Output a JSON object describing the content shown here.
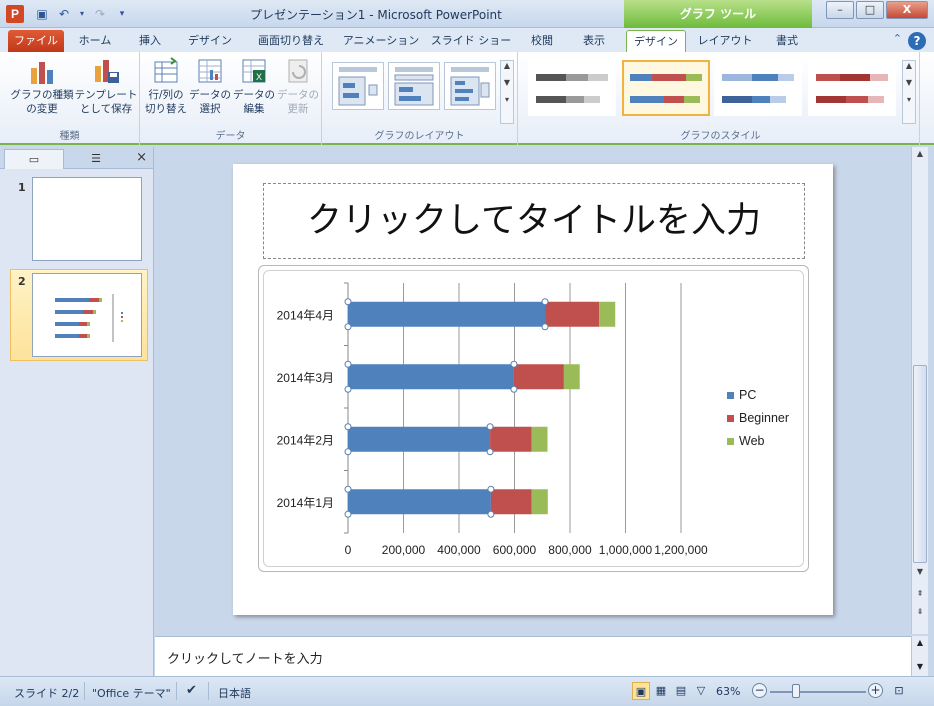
{
  "window": {
    "title": "プレゼンテーション1 - Microsoft PowerPoint",
    "contextual_tab": "グラフ ツール",
    "controls": {
      "minimize": "–",
      "maximize": "□",
      "close": "X"
    }
  },
  "tabs": [
    {
      "label": "ファイル"
    },
    {
      "label": "ホーム"
    },
    {
      "label": "挿入"
    },
    {
      "label": "デザイン"
    },
    {
      "label": "画面切り替え"
    },
    {
      "label": "アニメーション"
    },
    {
      "label": "スライド ショー"
    },
    {
      "label": "校閲"
    },
    {
      "label": "表示"
    },
    {
      "label": "デザイン"
    },
    {
      "label": "レイアウト"
    },
    {
      "label": "書式"
    }
  ],
  "ribbon": {
    "groups": {
      "type": {
        "label": "種類",
        "change_chart_type": "グラフの種類\nの変更",
        "save_template": "テンプレート\nとして保存"
      },
      "data": {
        "label": "データ",
        "switch_row_col": "行/列の\n切り替え",
        "select_data": "データの\n選択",
        "edit_data": "データの\n編集",
        "refresh_data": "データの\n更新"
      },
      "layouts": {
        "label": "グラフのレイアウト"
      },
      "styles": {
        "label": "グラフのスタイル"
      }
    }
  },
  "left_pane": {
    "slides": [
      {
        "number": "1"
      },
      {
        "number": "2"
      }
    ],
    "close": "×"
  },
  "slide": {
    "title_placeholder": "クリックしてタイトルを入力"
  },
  "chart_data": {
    "type": "bar",
    "orientation": "horizontal",
    "stacked": true,
    "categories": [
      "2014年1月",
      "2014年2月",
      "2014年3月",
      "2014年4月"
    ],
    "series": [
      {
        "name": "PC",
        "color": "#4f81bd",
        "values": [
          515000,
          512000,
          598000,
          710000
        ]
      },
      {
        "name": "Beginner",
        "color": "#c0504d",
        "values": [
          147000,
          150000,
          180000,
          195000
        ]
      },
      {
        "name": "Web",
        "color": "#9bbb59",
        "values": [
          58000,
          57000,
          57000,
          58000
        ]
      }
    ],
    "x_ticks": [
      "0",
      "200,000",
      "400,000",
      "600,000",
      "800,000",
      "1,000,000",
      "1,200,000"
    ],
    "xlim": [
      0,
      1200000
    ],
    "grid": true,
    "legend": "right"
  },
  "notes": {
    "placeholder": "クリックしてノートを入力"
  },
  "statusbar": {
    "slide_info": "スライド 2/2",
    "theme": "\"Office テーマ\"",
    "language": "日本語",
    "zoom": "63%",
    "minus": "−",
    "plus": "+"
  }
}
